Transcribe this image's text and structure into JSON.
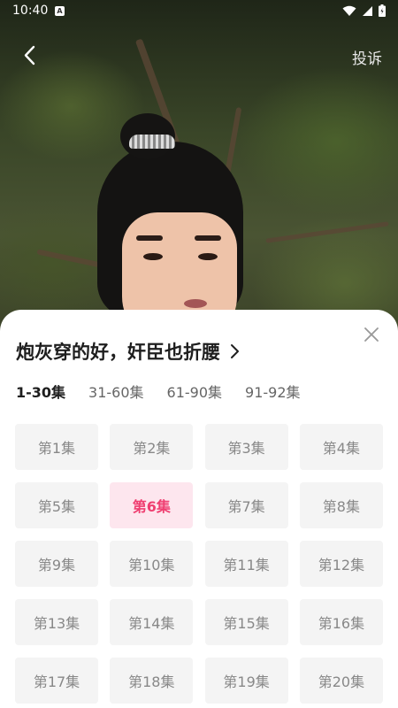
{
  "status_bar": {
    "time": "10:40",
    "notification_icon": "A",
    "icons": [
      "wifi-icon",
      "signal-icon",
      "battery-icon"
    ]
  },
  "header": {
    "back_icon": "chevron-left-icon",
    "report_label": "投诉"
  },
  "sheet": {
    "title": "炮灰穿的好，奸臣也折腰",
    "close_icon": "close-icon",
    "tabs": [
      {
        "label": "1-30集",
        "active": true
      },
      {
        "label": "31-60集",
        "active": false
      },
      {
        "label": "61-90集",
        "active": false
      },
      {
        "label": "91-92集",
        "active": false
      }
    ],
    "current_episode": "第6集",
    "episodes": [
      "第1集",
      "第2集",
      "第3集",
      "第4集",
      "第5集",
      "第6集",
      "第7集",
      "第8集",
      "第9集",
      "第10集",
      "第11集",
      "第12集",
      "第13集",
      "第14集",
      "第15集",
      "第16集",
      "第17集",
      "第18集",
      "第19集",
      "第20集"
    ]
  },
  "colors": {
    "accent": "#ef3f71",
    "accent_bg": "#fde6ee",
    "tile_bg": "#f4f4f4"
  }
}
